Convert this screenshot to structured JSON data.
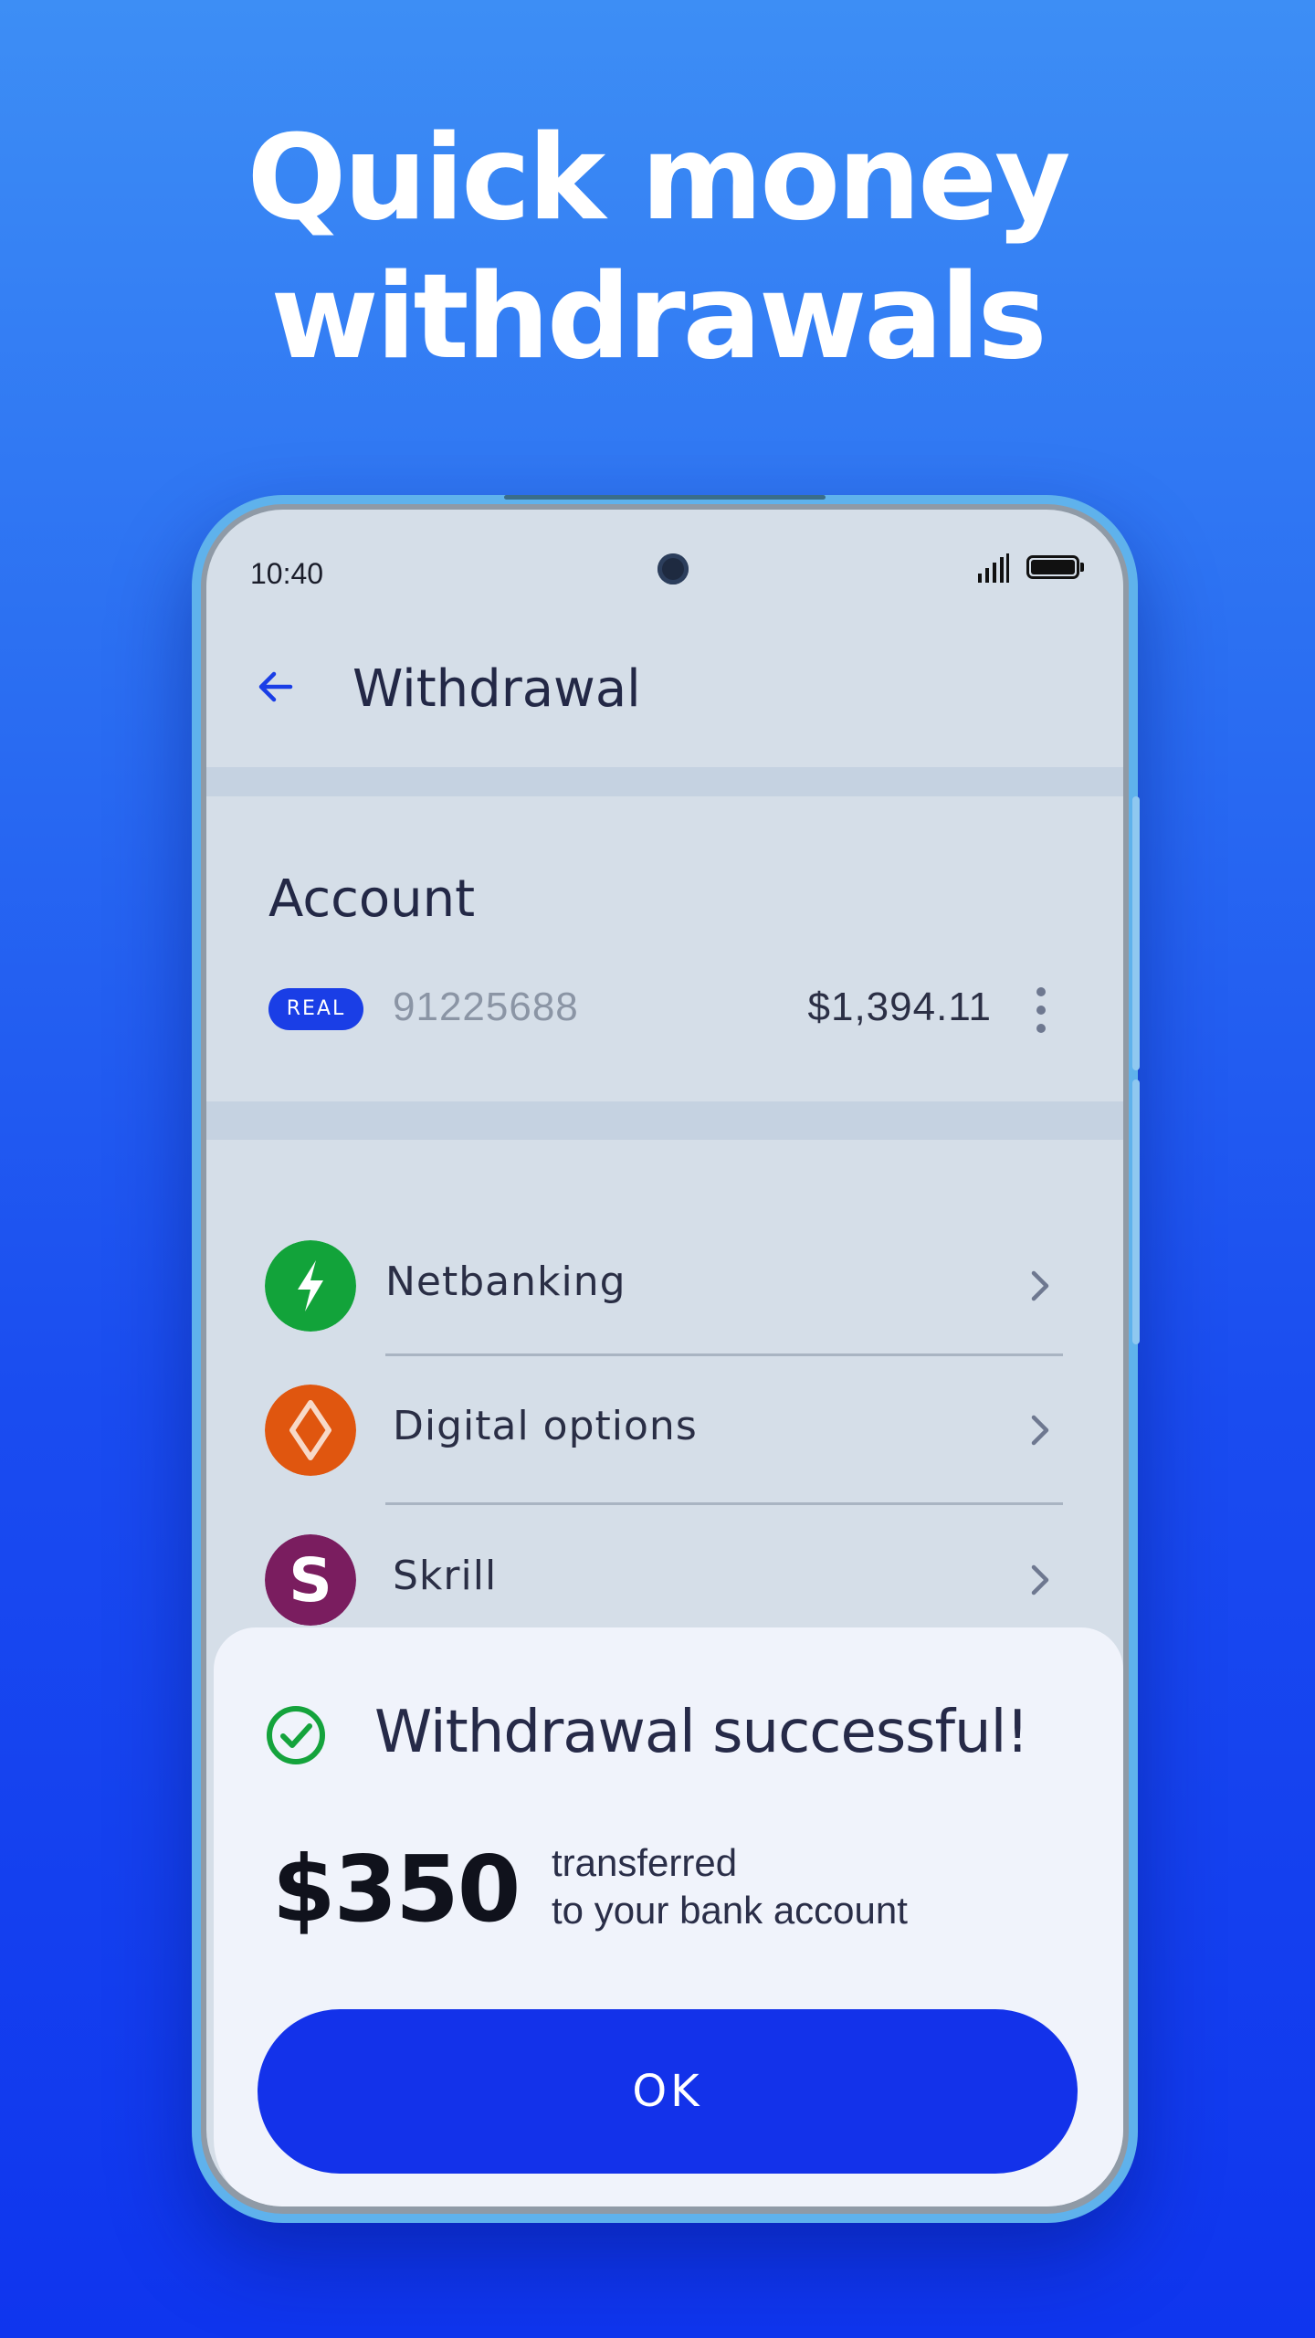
{
  "hero": {
    "line1": "Quick money",
    "line2": "withdrawals"
  },
  "status_bar": {
    "time": "10:40",
    "signal_icon": "signal-bars-icon",
    "battery_icon": "battery-full-icon"
  },
  "app_bar": {
    "back_icon": "arrow-left-icon",
    "title": "Withdrawal"
  },
  "account": {
    "title": "Account",
    "badge": "REAL",
    "number": "91225688",
    "balance": "$1,394.11",
    "menu_icon": "more-vertical-icon"
  },
  "methods": [
    {
      "label": "Netbanking",
      "icon": "lightning-icon",
      "color": "#12a33a"
    },
    {
      "label": "Digital options",
      "icon": "diamond-icon",
      "color": "#e0560f"
    },
    {
      "label": "Skrill",
      "icon": "skrill-s-icon",
      "color": "#7a1d5f"
    }
  ],
  "success_sheet": {
    "title": "Withdrawal successful!",
    "amount": "$350",
    "desc_line1": "transferred",
    "desc_line2": "to your bank account",
    "ok_label": "OK",
    "check_icon": "check-circle-icon"
  },
  "colors": {
    "accent": "#1332ea",
    "check": "#14a33c",
    "screen_bg": "#d5dee8",
    "sheet_bg": "#f0f3fb"
  }
}
